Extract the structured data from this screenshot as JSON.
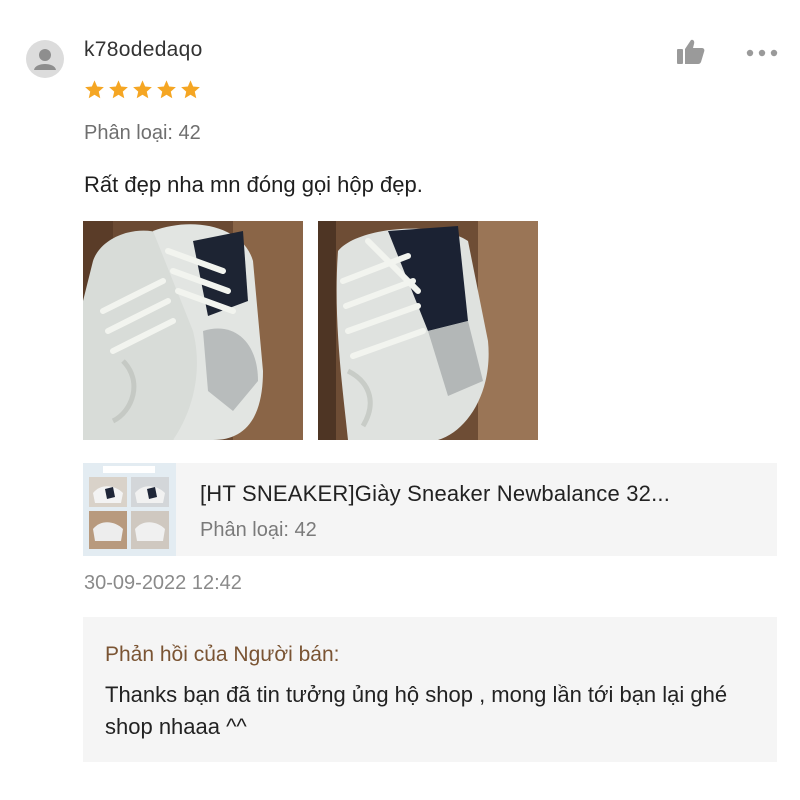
{
  "review": {
    "username": "k78odedaqo",
    "rating": 5,
    "variant_label": "Phân loại: 42",
    "text": "Rất đẹp nha mn đóng gọi hộp đẹp.",
    "timestamp": "30-09-2022 12:42"
  },
  "icons": {
    "avatar": "user-avatar-icon",
    "like": "thumbs-up-icon",
    "more": "more-dots-icon",
    "star": "star-icon"
  },
  "colors": {
    "star": "#f5a623",
    "seller_label": "#7a5433",
    "card_bg": "#f5f5f5"
  },
  "product": {
    "title": "[HT SNEAKER]Giày Sneaker Newbalance 32...",
    "variant_label": "Phân loại: 42"
  },
  "seller_reply": {
    "label": "Phản hồi của Người bán:",
    "text": "Thanks bạn đã tin tưởng ủng hộ shop , mong lần tới bạn lại ghé shop nhaaa ^^"
  }
}
